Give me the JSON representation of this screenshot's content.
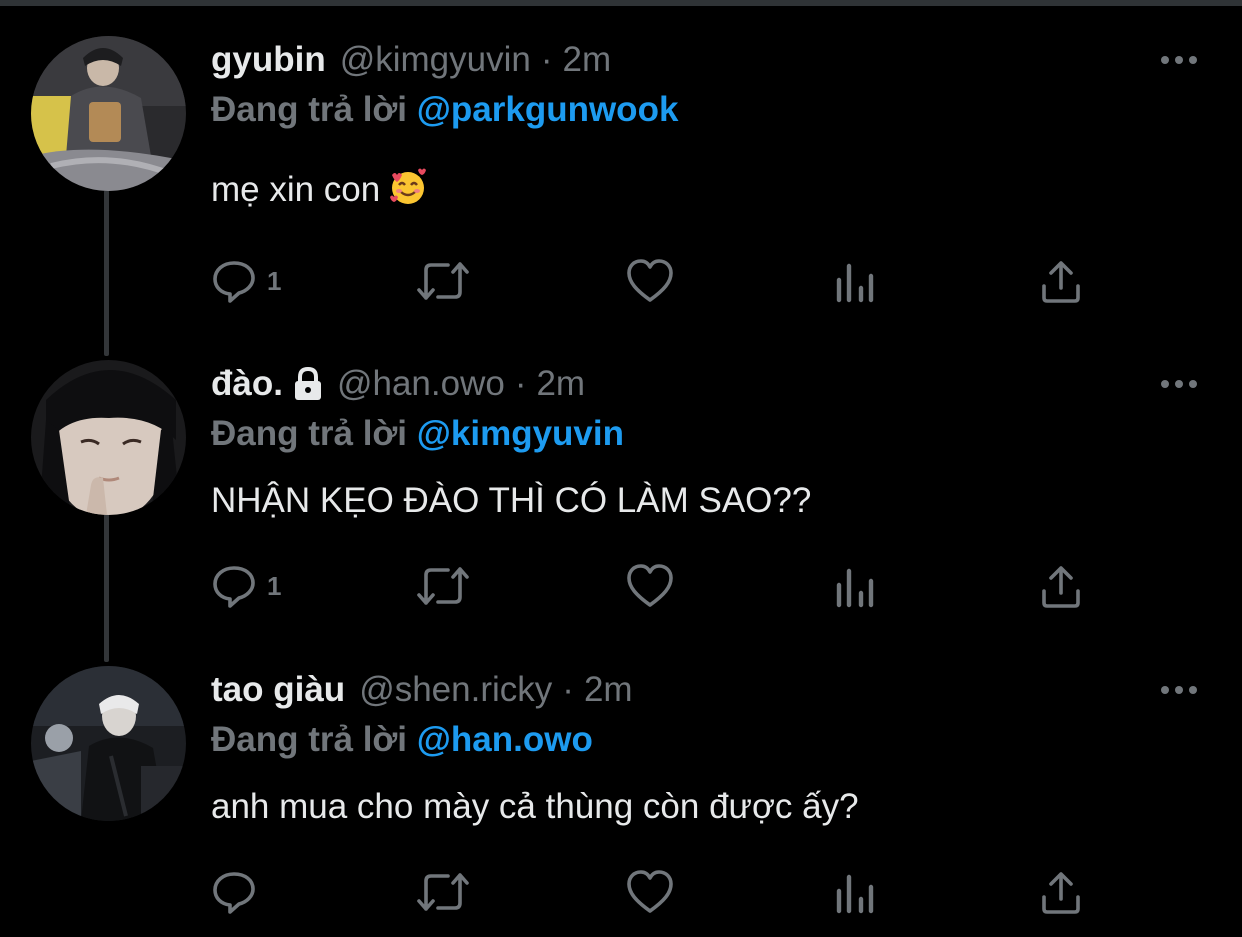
{
  "tweets": [
    {
      "name": "gyubin",
      "handle": "@kimgyuvin",
      "separator": "·",
      "time": "2m",
      "replying_prefix": "Đang trả lời",
      "replying_to": "@parkgunwook",
      "text": "mẹ xin con",
      "emoji": "smiling-face-with-hearts-icon",
      "reply_count": "1",
      "avatar": "avatar-person-holding-bag"
    },
    {
      "name": "đào.",
      "locked": true,
      "handle": "@han.owo",
      "separator": "·",
      "time": "2m",
      "replying_prefix": "Đang trả lời",
      "replying_to": "@kimgyuvin",
      "text": "NHẬN KẸO ĐÀO THÌ CÓ LÀM SAO??",
      "reply_count": "1",
      "avatar": "avatar-person-closeup"
    },
    {
      "name": "tao giàu",
      "handle": "@shen.ricky",
      "separator": "·",
      "time": "2m",
      "replying_prefix": "Đang trả lời",
      "replying_to": "@han.owo",
      "text": "anh mua cho mày cả thùng còn được ấy?",
      "reply_count": "",
      "avatar": "avatar-person-dark-outfit"
    }
  ],
  "colors": {
    "background": "#000000",
    "text": "#e7e9ea",
    "secondary": "#71767b",
    "link": "#1d9bf0",
    "thread_line": "#333639"
  },
  "icons": [
    "reply-icon",
    "retweet-icon",
    "like-icon",
    "views-icon",
    "share-icon",
    "more-options-icon",
    "lock-icon"
  ]
}
